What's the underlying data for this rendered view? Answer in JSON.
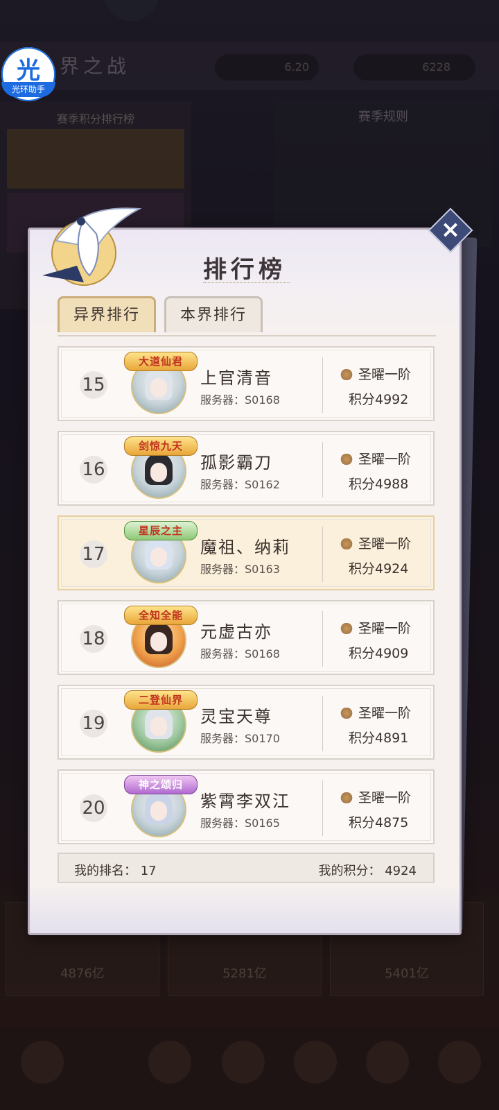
{
  "background": {
    "title": "界之战",
    "stat1": "6.20",
    "stat2": "6228",
    "left_panel_header": "赛季积分排行榜",
    "right_panel_header": "赛季规则",
    "bottom_cards": [
      "4876亿",
      "5281亿",
      "5401亿"
    ],
    "helper_glyph": "光",
    "helper_label": "光环助手"
  },
  "dialog": {
    "title": "排行榜",
    "close_icon": "close-icon",
    "tabs": [
      {
        "label": "异界排行",
        "active": true
      },
      {
        "label": "本界排行",
        "active": false
      }
    ],
    "rows": [
      {
        "rank": "15",
        "badge": "大道仙君",
        "name": "上官清音",
        "server": "服务器：S0168",
        "tier": "圣曜一阶",
        "score": "积分4992"
      },
      {
        "rank": "16",
        "badge": "剑惊九天",
        "name": "孤影霸刀",
        "server": "服务器：S0162",
        "tier": "圣曜一阶",
        "score": "积分4988"
      },
      {
        "rank": "17",
        "badge": "星辰之主",
        "name": "魔祖、纳莉",
        "server": "服务器：S0163",
        "tier": "圣曜一阶",
        "score": "积分4924"
      },
      {
        "rank": "18",
        "badge": "全知全能",
        "name": "元虚古亦",
        "server": "服务器：S0168",
        "tier": "圣曜一阶",
        "score": "积分4909"
      },
      {
        "rank": "19",
        "badge": "二登仙界",
        "name": "灵宝天尊",
        "server": "服务器：S0170",
        "tier": "圣曜一阶",
        "score": "积分4891"
      },
      {
        "rank": "20",
        "badge": "神之颂归",
        "name": "紫霄李双江",
        "server": "服务器：S0165",
        "tier": "圣曜一阶",
        "score": "积分4875"
      }
    ],
    "footer": {
      "my_rank": "我的排名：  17",
      "my_score": "我的积分：  4924"
    }
  }
}
